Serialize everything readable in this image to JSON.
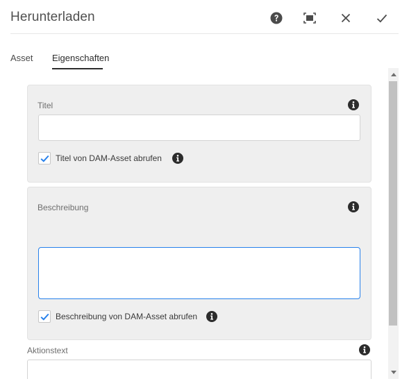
{
  "dialog": {
    "title": "Herunterladen",
    "icons": {
      "help": "help-circle-icon",
      "fullscreen": "fullscreen-icon",
      "close": "close-icon",
      "done": "checkmark-icon"
    }
  },
  "tabs": [
    {
      "label": "Asset",
      "active": false
    },
    {
      "label": "Eigenschaften",
      "active": true
    }
  ],
  "fields": {
    "title": {
      "label": "Titel",
      "value": "",
      "checkbox_label": "Titel von DAM-Asset abrufen",
      "checked": true
    },
    "description": {
      "label": "Beschreibung",
      "value": "",
      "checkbox_label": "Beschreibung von DAM-Asset abrufen",
      "checked": true
    },
    "action_text": {
      "label": "Aktionstext",
      "value": ""
    }
  },
  "colors": {
    "checkbox_check": "#2680eb",
    "focus_border": "#2680eb",
    "panel_bg": "#efefef",
    "scroll_thumb": "#c1c1c1"
  }
}
